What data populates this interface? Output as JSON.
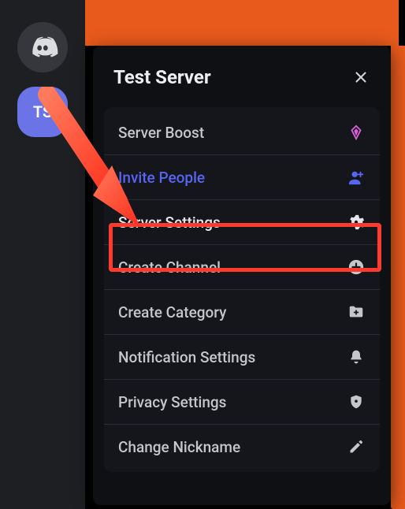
{
  "accent": {
    "orange": "#e85a1c",
    "highlight": "#ff3b30",
    "blurple": "#5865f2",
    "boost": "#d960d9"
  },
  "sidebar": {
    "home_glyph": "discord",
    "selected_initials": "TS",
    "items": [
      {
        "label": "TS"
      }
    ]
  },
  "panel": {
    "title": "Test Server",
    "close_label": "✕"
  },
  "menu": {
    "boost": {
      "label": "Server Boost"
    },
    "invite": {
      "label": "Invite People"
    },
    "settings": {
      "label": "Server Settings"
    },
    "create_chan": {
      "label": "Create Channel"
    },
    "create_cat": {
      "label": "Create Category"
    },
    "notif": {
      "label": "Notification Settings"
    },
    "privacy": {
      "label": "Privacy Settings"
    },
    "nickname": {
      "label": "Change Nickname"
    }
  },
  "annotation": {
    "highlighted_item": "Server Settings"
  }
}
